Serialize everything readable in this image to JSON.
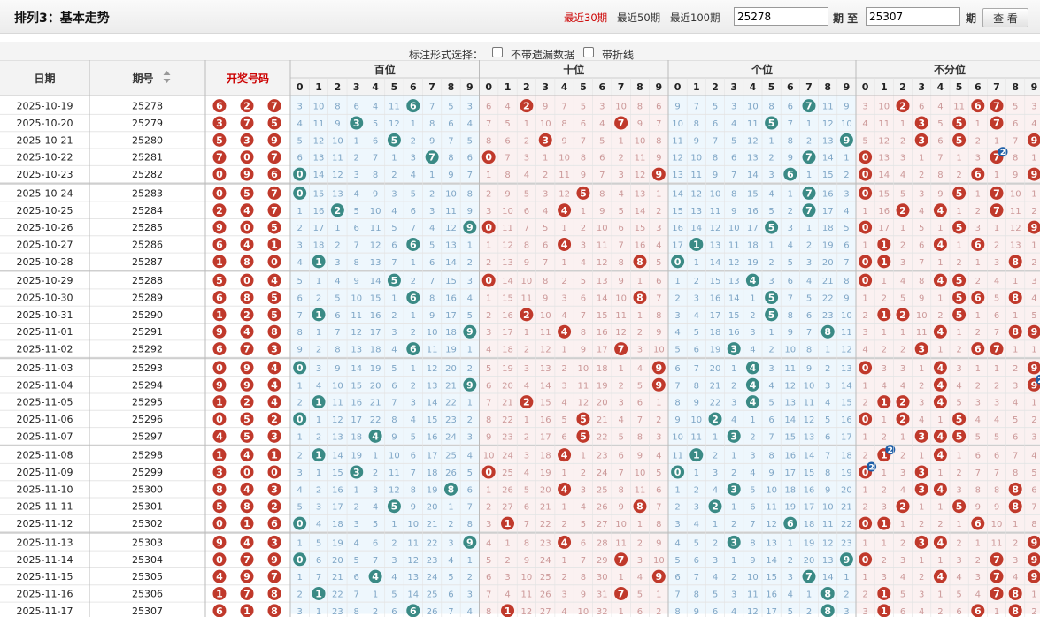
{
  "header": {
    "title": "排列3：基本走势",
    "periods": [
      "最近30期",
      "最近50期",
      "最近100期"
    ],
    "active_period": 0,
    "from_value": "25278",
    "from_label": "期 至",
    "to_value": "25307",
    "to_label": "期",
    "view_button": "查 看"
  },
  "options": {
    "label": "标注形式选择：",
    "opt1": "不带遗漏数据",
    "opt2": "带折线"
  },
  "table": {
    "col_date": "日期",
    "col_issue": "期号",
    "col_draw": "开奖号码",
    "groups": [
      "百位",
      "十位",
      "个位",
      "不分位"
    ],
    "digits": [
      "0",
      "1",
      "2",
      "3",
      "4",
      "5",
      "6",
      "7",
      "8",
      "9"
    ],
    "rows": [
      {
        "d": "2025-10-19",
        "i": "25278",
        "n": [
          6,
          2,
          7
        ]
      },
      {
        "d": "2025-10-20",
        "i": "25279",
        "n": [
          3,
          7,
          5
        ]
      },
      {
        "d": "2025-10-21",
        "i": "25280",
        "n": [
          5,
          3,
          9
        ]
      },
      {
        "d": "2025-10-22",
        "i": "25281",
        "n": [
          7,
          0,
          7
        ]
      },
      {
        "d": "2025-10-23",
        "i": "25282",
        "n": [
          0,
          9,
          6
        ]
      },
      {
        "d": "2025-10-24",
        "i": "25283",
        "n": [
          0,
          5,
          7
        ]
      },
      {
        "d": "2025-10-25",
        "i": "25284",
        "n": [
          2,
          4,
          7
        ]
      },
      {
        "d": "2025-10-26",
        "i": "25285",
        "n": [
          9,
          0,
          5
        ]
      },
      {
        "d": "2025-10-27",
        "i": "25286",
        "n": [
          6,
          4,
          1
        ]
      },
      {
        "d": "2025-10-28",
        "i": "25287",
        "n": [
          1,
          8,
          0
        ]
      },
      {
        "d": "2025-10-29",
        "i": "25288",
        "n": [
          5,
          0,
          4
        ]
      },
      {
        "d": "2025-10-30",
        "i": "25289",
        "n": [
          6,
          8,
          5
        ]
      },
      {
        "d": "2025-10-31",
        "i": "25290",
        "n": [
          1,
          2,
          5
        ]
      },
      {
        "d": "2025-11-01",
        "i": "25291",
        "n": [
          9,
          4,
          8
        ]
      },
      {
        "d": "2025-11-02",
        "i": "25292",
        "n": [
          6,
          7,
          3
        ]
      },
      {
        "d": "2025-11-03",
        "i": "25293",
        "n": [
          0,
          9,
          4
        ]
      },
      {
        "d": "2025-11-04",
        "i": "25294",
        "n": [
          9,
          9,
          4
        ]
      },
      {
        "d": "2025-11-05",
        "i": "25295",
        "n": [
          1,
          2,
          4
        ]
      },
      {
        "d": "2025-11-06",
        "i": "25296",
        "n": [
          0,
          5,
          2
        ]
      },
      {
        "d": "2025-11-07",
        "i": "25297",
        "n": [
          4,
          5,
          3
        ]
      },
      {
        "d": "2025-11-08",
        "i": "25298",
        "n": [
          1,
          4,
          1
        ]
      },
      {
        "d": "2025-11-09",
        "i": "25299",
        "n": [
          3,
          0,
          0
        ]
      },
      {
        "d": "2025-11-10",
        "i": "25300",
        "n": [
          8,
          4,
          3
        ]
      },
      {
        "d": "2025-11-11",
        "i": "25301",
        "n": [
          5,
          8,
          2
        ]
      },
      {
        "d": "2025-11-12",
        "i": "25302",
        "n": [
          0,
          1,
          6
        ]
      },
      {
        "d": "2025-11-13",
        "i": "25303",
        "n": [
          9,
          4,
          3
        ]
      },
      {
        "d": "2025-11-14",
        "i": "25304",
        "n": [
          0,
          7,
          9
        ]
      },
      {
        "d": "2025-11-15",
        "i": "25305",
        "n": [
          4,
          9,
          7
        ]
      },
      {
        "d": "2025-11-16",
        "i": "25306",
        "n": [
          1,
          7,
          8
        ]
      },
      {
        "d": "2025-11-17",
        "i": "25307",
        "n": [
          6,
          1,
          8
        ]
      }
    ]
  },
  "colors": {
    "red_ball": "#c0392b",
    "teal_ball": "#3a8a85",
    "blue_ball": "#1f5fa8",
    "group1_bg": "#eef7fd",
    "group2_bg": "#fbf1f1",
    "group3_bg": "#eef7fd",
    "group4_bg": "#fbf1f1",
    "miss_blue": "#7fa6c6",
    "miss_red": "#c99",
    "accent": "#c00"
  }
}
